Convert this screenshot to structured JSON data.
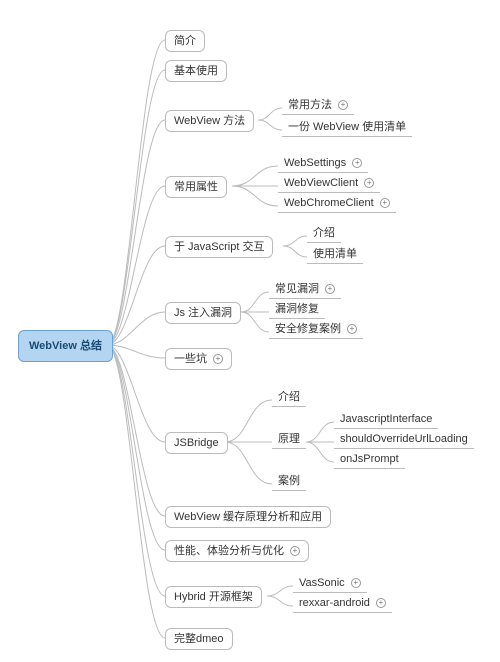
{
  "root": {
    "label": "WebView 总结"
  },
  "level1": {
    "intro": "简介",
    "basic_use": "基本使用",
    "methods": "WebView 方法",
    "attrs": "常用属性",
    "js_interact": "于 JavaScript 交互",
    "js_inject": "Js 注入漏洞",
    "pitfalls": "一些坑",
    "jsbridge": "JSBridge",
    "cache": "WebView 缓存原理分析和应用",
    "perf": "性能、体验分析与优化",
    "hybrid": "Hybrid 开源框架",
    "demo": "完整dmeo"
  },
  "methods_children": {
    "common_methods": "常用方法",
    "usage_list": "一份 WebView 使用清单"
  },
  "attrs_children": {
    "websettings": "WebSettings",
    "webviewclient": "WebViewClient",
    "webchromeclient": "WebChromeClient"
  },
  "js_interact_children": {
    "intro": "介绍",
    "usage_list": "使用清单"
  },
  "js_inject_children": {
    "common_vulns": "常见漏洞",
    "fix": "漏洞修复",
    "safe_fix_case": "安全修复案例"
  },
  "jsbridge_children": {
    "intro": "介绍",
    "principle": "原理",
    "case": "案例"
  },
  "jsbridge_principle_children": {
    "jsinterface": "JavascriptInterface",
    "shouldoverride": "shouldOverrideUrlLoading",
    "onjsprompt": "onJsPrompt"
  },
  "hybrid_children": {
    "vassonic": "VasSonic",
    "rexxar": "rexxar-android"
  }
}
